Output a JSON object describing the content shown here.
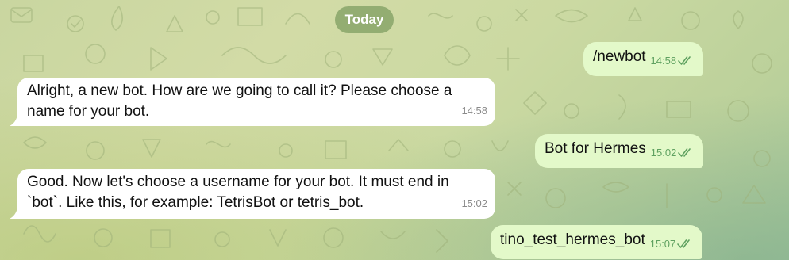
{
  "date_separator": "Today",
  "messages": [
    {
      "direction": "out",
      "text": "/newbot",
      "time": "14:58",
      "status": "read"
    },
    {
      "direction": "in",
      "text": "Alright, a new bot. How are we going to call it? Please choose a\nname for your bot.",
      "time": "14:58"
    },
    {
      "direction": "out",
      "text": "Bot for Hermes",
      "time": "15:02",
      "status": "read"
    },
    {
      "direction": "in",
      "text": "Good. Now let's choose a username for your bot. It must end in\n`bot`. Like this, for example: TetrisBot or tetris_bot.",
      "time": "15:02"
    },
    {
      "direction": "out",
      "text": "tino_test_hermes_bot",
      "time": "15:07",
      "status": "read"
    }
  ],
  "colors": {
    "incoming_bubble": "#ffffff",
    "outgoing_bubble": "#e3f9c9",
    "outgoing_meta": "#5fa160",
    "date_chip": "#82a064"
  },
  "icons": {
    "read_receipt": "double-check-icon"
  }
}
